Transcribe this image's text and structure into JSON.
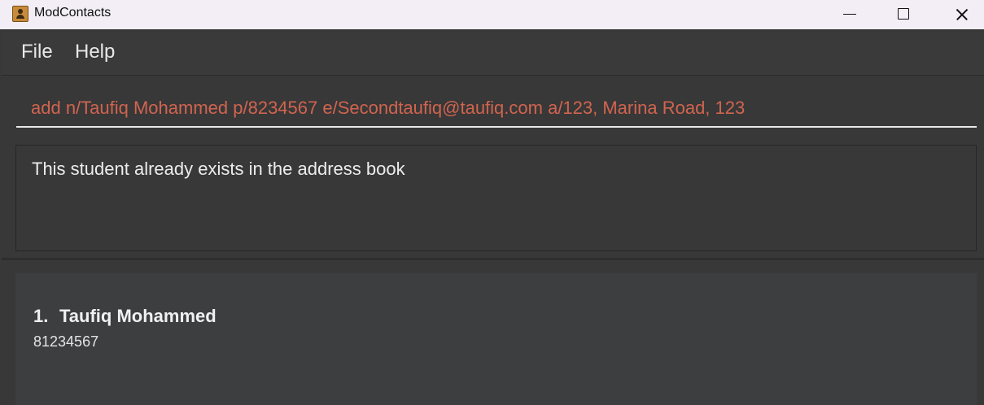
{
  "window": {
    "title": "ModContacts"
  },
  "menu": {
    "items": [
      "File",
      "Help"
    ]
  },
  "command": {
    "value": "add n/Taufiq Mohammed p/8234567 e/Secondtaufiq@taufiq.com a/123, Marina Road, 123"
  },
  "result": {
    "message": "This student already exists in the address book"
  },
  "contacts": [
    {
      "index": "1.",
      "name": "Taufiq Mohammed",
      "phone": "81234567"
    }
  ],
  "colors": {
    "command_text": "#d1644f",
    "background": "#383838",
    "titlebar": "#f3eef5"
  }
}
